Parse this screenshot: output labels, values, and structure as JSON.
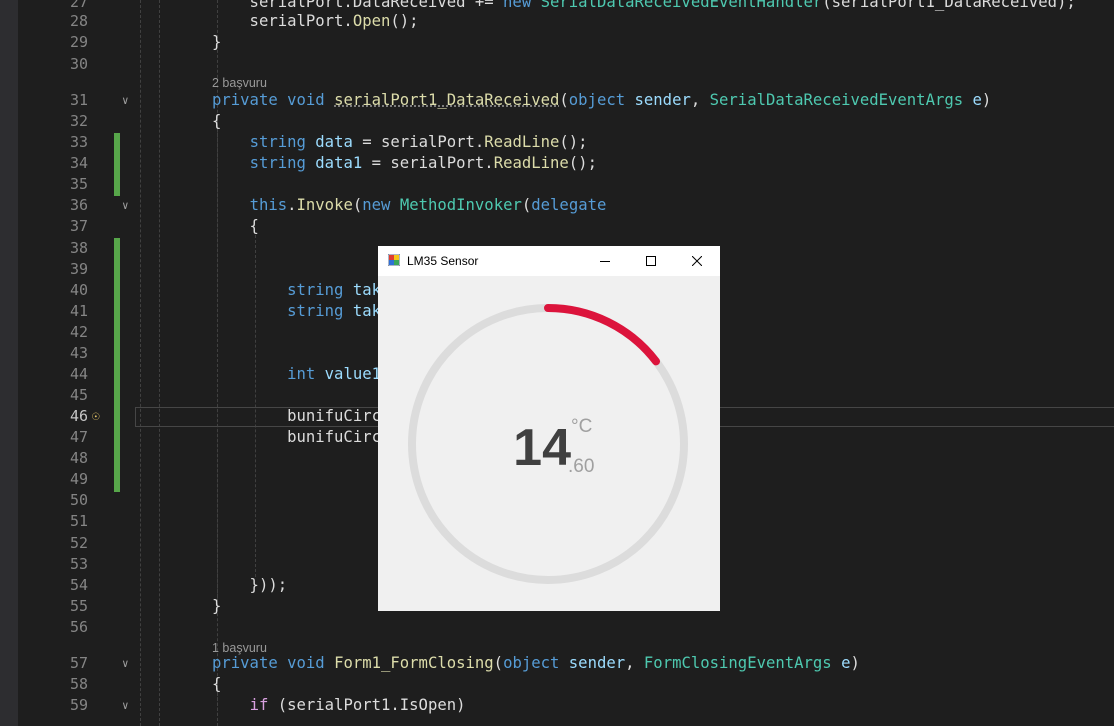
{
  "editor": {
    "lines": [
      {
        "n": "27",
        "segs": [
          {
            "t": "    serialPort.DataReceived += ",
            "c": ""
          },
          {
            "t": "new",
            "c": "kw"
          },
          {
            "t": " ",
            "c": ""
          },
          {
            "t": "SerialDataReceivedEventHandler",
            "c": "ty"
          },
          {
            "t": "(serialPort1_DataReceived);",
            "c": ""
          }
        ]
      },
      {
        "n": "28",
        "segs": [
          {
            "t": "    serialPort.",
            "c": ""
          },
          {
            "t": "Open",
            "c": "mth"
          },
          {
            "t": "();",
            "c": ""
          }
        ]
      },
      {
        "n": "29",
        "segs": [
          {
            "t": "}",
            "c": ""
          }
        ]
      },
      {
        "n": "30",
        "segs": []
      },
      {
        "n": "31",
        "fold": true,
        "segs": [
          {
            "t": "private",
            "c": "kw"
          },
          {
            "t": " ",
            "c": ""
          },
          {
            "t": "void",
            "c": "kw"
          },
          {
            "t": " ",
            "c": ""
          },
          {
            "t": "serialPort1_DataReceived",
            "c": "mth sq"
          },
          {
            "t": "(",
            "c": ""
          },
          {
            "t": "object",
            "c": "kw"
          },
          {
            "t": " ",
            "c": ""
          },
          {
            "t": "sender",
            "c": "var"
          },
          {
            "t": ", ",
            "c": ""
          },
          {
            "t": "SerialDataReceivedEventArgs",
            "c": "ty"
          },
          {
            "t": " ",
            "c": ""
          },
          {
            "t": "e",
            "c": "var"
          },
          {
            "t": ")",
            "c": ""
          }
        ]
      },
      {
        "n": "32",
        "segs": [
          {
            "t": "{",
            "c": ""
          }
        ]
      },
      {
        "n": "33",
        "segs": [
          {
            "t": "    ",
            "c": ""
          },
          {
            "t": "string",
            "c": "kw"
          },
          {
            "t": " ",
            "c": ""
          },
          {
            "t": "data",
            "c": "var"
          },
          {
            "t": " = serialPort.",
            "c": ""
          },
          {
            "t": "ReadLine",
            "c": "mth"
          },
          {
            "t": "();",
            "c": ""
          }
        ]
      },
      {
        "n": "34",
        "segs": [
          {
            "t": "    ",
            "c": ""
          },
          {
            "t": "string",
            "c": "kw"
          },
          {
            "t": " ",
            "c": ""
          },
          {
            "t": "data1",
            "c": "var"
          },
          {
            "t": " = serialPort.",
            "c": ""
          },
          {
            "t": "ReadLine",
            "c": "mth"
          },
          {
            "t": "();",
            "c": ""
          }
        ]
      },
      {
        "n": "35",
        "segs": []
      },
      {
        "n": "36",
        "fold": true,
        "segs": [
          {
            "t": "    ",
            "c": ""
          },
          {
            "t": "this",
            "c": "kw"
          },
          {
            "t": ".",
            "c": ""
          },
          {
            "t": "Invoke",
            "c": "mth"
          },
          {
            "t": "(",
            "c": ""
          },
          {
            "t": "new",
            "c": "kw"
          },
          {
            "t": " ",
            "c": ""
          },
          {
            "t": "MethodInvoker",
            "c": "ty"
          },
          {
            "t": "(",
            "c": ""
          },
          {
            "t": "delegate",
            "c": "kw"
          }
        ]
      },
      {
        "n": "37",
        "segs": [
          {
            "t": "    {",
            "c": ""
          }
        ]
      },
      {
        "n": "38",
        "segs": []
      },
      {
        "n": "39",
        "segs": []
      },
      {
        "n": "40",
        "segs": [
          {
            "t": "        ",
            "c": ""
          },
          {
            "t": "string",
            "c": "kw"
          },
          {
            "t": " ",
            "c": ""
          },
          {
            "t": "tak",
            "c": "var"
          }
        ]
      },
      {
        "n": "41",
        "segs": [
          {
            "t": "        ",
            "c": ""
          },
          {
            "t": "string",
            "c": "kw"
          },
          {
            "t": " ",
            "c": ""
          },
          {
            "t": "tak",
            "c": "var"
          }
        ]
      },
      {
        "n": "42",
        "segs": []
      },
      {
        "n": "43",
        "segs": []
      },
      {
        "n": "44",
        "segs": [
          {
            "t": "        ",
            "c": ""
          },
          {
            "t": "int",
            "c": "kw"
          },
          {
            "t": " ",
            "c": ""
          },
          {
            "t": "value1",
            "c": "var"
          }
        ]
      },
      {
        "n": "45",
        "segs": []
      },
      {
        "n": "46",
        "current": true,
        "bulb": true,
        "segs": [
          {
            "t": "        bunifuCirc",
            "c": ""
          }
        ]
      },
      {
        "n": "47",
        "segs": [
          {
            "t": "        bunifuCirc",
            "c": ""
          }
        ]
      },
      {
        "n": "48",
        "segs": []
      },
      {
        "n": "49",
        "segs": []
      },
      {
        "n": "50",
        "segs": []
      },
      {
        "n": "51",
        "segs": []
      },
      {
        "n": "52",
        "segs": []
      },
      {
        "n": "53",
        "segs": []
      },
      {
        "n": "54",
        "segs": [
          {
            "t": "    }));",
            "c": ""
          }
        ]
      },
      {
        "n": "55",
        "segs": [
          {
            "t": "}",
            "c": ""
          }
        ]
      },
      {
        "n": "56",
        "segs": []
      },
      {
        "n": "57",
        "fold": true,
        "segs": [
          {
            "t": "private",
            "c": "kw"
          },
          {
            "t": " ",
            "c": ""
          },
          {
            "t": "void",
            "c": "kw"
          },
          {
            "t": " ",
            "c": ""
          },
          {
            "t": "Form1_FormClosing",
            "c": "mth"
          },
          {
            "t": "(",
            "c": ""
          },
          {
            "t": "object",
            "c": "kw"
          },
          {
            "t": " ",
            "c": ""
          },
          {
            "t": "sender",
            "c": "var"
          },
          {
            "t": ", ",
            "c": ""
          },
          {
            "t": "FormClosingEventArgs",
            "c": "ty"
          },
          {
            "t": " ",
            "c": ""
          },
          {
            "t": "e",
            "c": "var"
          },
          {
            "t": ")",
            "c": ""
          }
        ]
      },
      {
        "n": "58",
        "segs": [
          {
            "t": "{",
            "c": ""
          }
        ]
      },
      {
        "n": "59",
        "fold": true,
        "segs": [
          {
            "t": "    ",
            "c": ""
          },
          {
            "t": "if",
            "c": "ctl"
          },
          {
            "t": " (serialPort1.IsOpen)",
            "c": ""
          }
        ]
      }
    ],
    "hints": [
      "2 başvuru",
      "1 başvuru"
    ]
  },
  "window": {
    "title": "LM35 Sensor",
    "icon": "winforms-app-icon",
    "controls": [
      "minimize-icon",
      "maximize-icon",
      "close-icon"
    ]
  },
  "gauge": {
    "value_int": "14",
    "value_dec": ".60",
    "unit": "°C",
    "progress_fraction": 0.146,
    "progress_color": "#dc143c",
    "track_color": "#dcdcdc"
  }
}
